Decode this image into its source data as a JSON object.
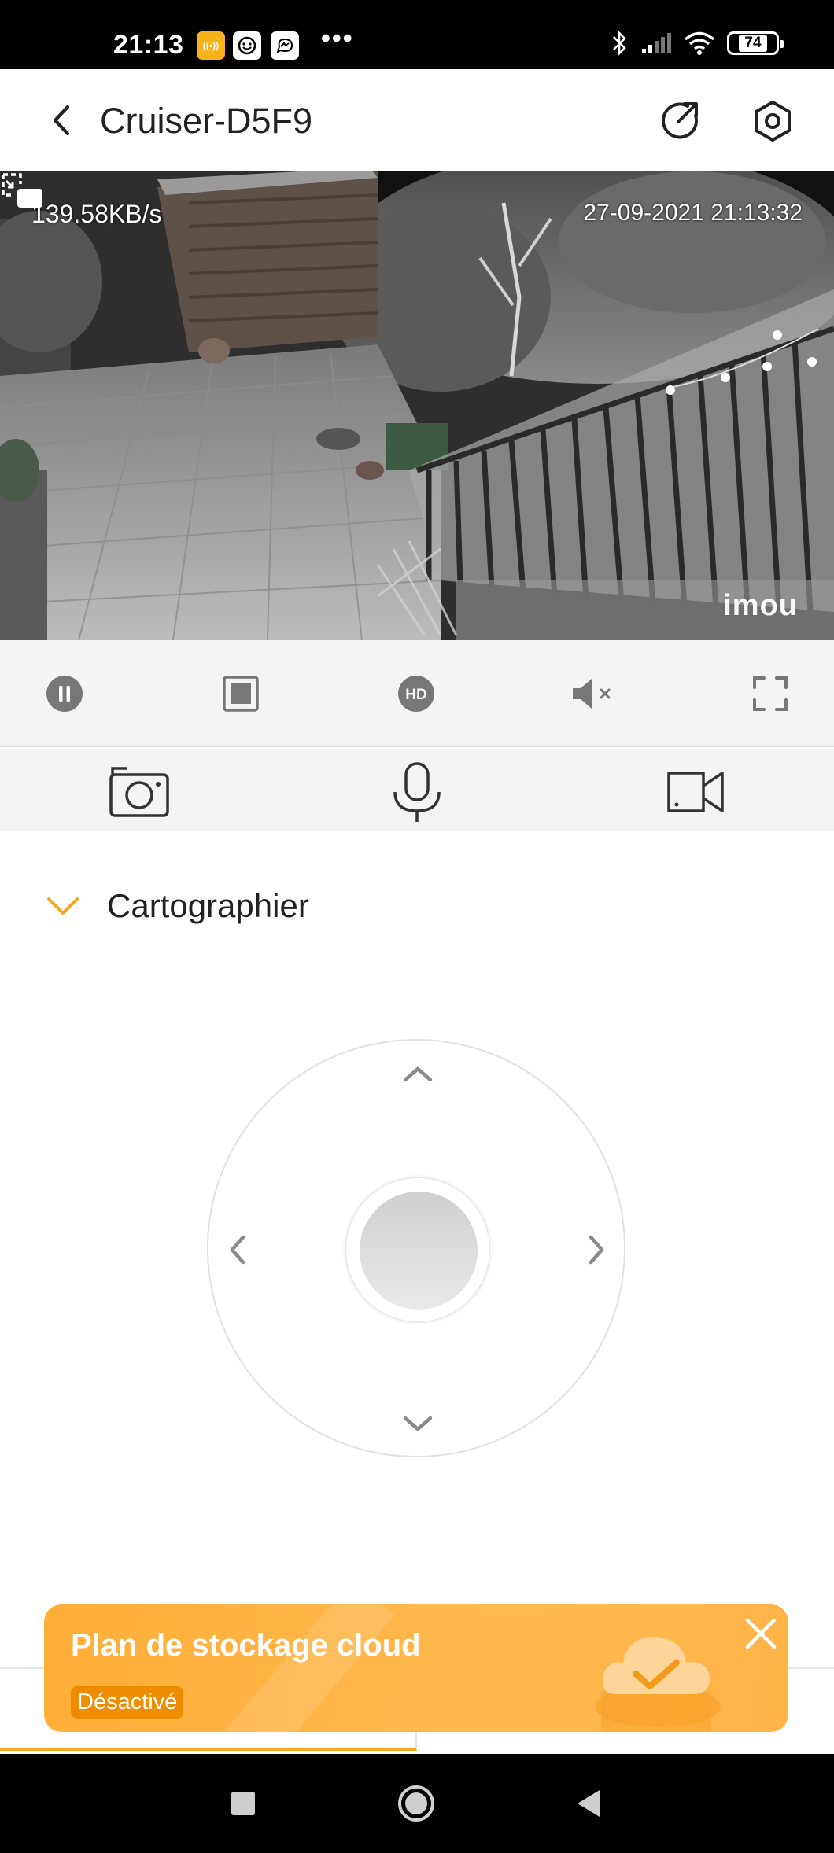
{
  "status_bar": {
    "time": "21:13",
    "battery": "74",
    "notification_icons": [
      "hotspot-icon",
      "smiley-icon",
      "messenger-icon"
    ],
    "more": "•••"
  },
  "header": {
    "title": "Cruiser-D5F9"
  },
  "video": {
    "bitrate": "139.58KB/s",
    "timestamp": "27-09-2021 21:13:32",
    "watermark": "imou"
  },
  "controls": [
    "pause-icon",
    "stop-icon",
    "hd-icon",
    "mute-icon",
    "fullscreen-icon"
  ],
  "actions": [
    "snapshot-icon",
    "microphone-icon",
    "record-icon"
  ],
  "ptz": {
    "section_label": "Cartographier"
  },
  "cloud_banner": {
    "title": "Plan de stockage cloud",
    "status": "Désactivé"
  },
  "colors": {
    "accent": "#f5a623",
    "banner": "#ffb448",
    "badge": "#f08c00"
  }
}
